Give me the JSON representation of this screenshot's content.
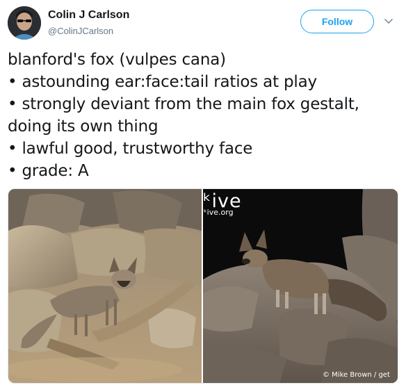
{
  "user": {
    "name": "Colin J Carlson",
    "handle": "@ColinJCarlson",
    "avatar_icon": "profile-photo"
  },
  "actions": {
    "follow_label": "Follow",
    "menu_icon": "chevron-down-icon"
  },
  "tweet": {
    "lines": [
      "blanford's fox (vulpes cana)",
      "• astounding ear:face:tail ratios at play",
      "• strongly deviant from the main fox gestalt,",
      "doing its own thing",
      "• lawful good, trustworthy face",
      "• grade: A"
    ]
  },
  "media": {
    "watermark_logo": "ᵏive",
    "watermark_url": "ᵏive.org",
    "credit": "© Mike Brown / get"
  },
  "colors": {
    "accent": "#1da1f2",
    "text": "#14171a",
    "secondary": "#657786"
  }
}
